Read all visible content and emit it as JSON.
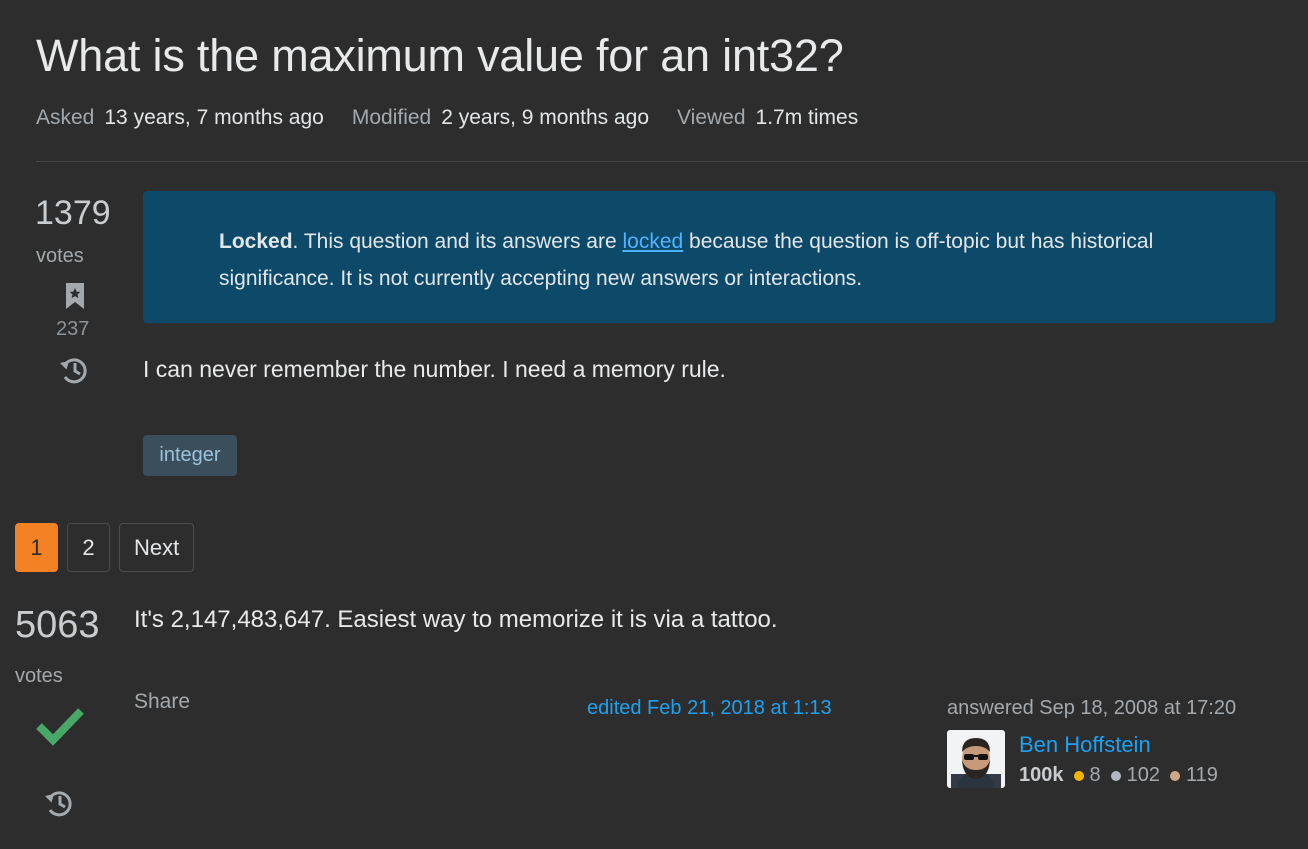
{
  "question": {
    "title": "What is the maximum value for an int32?",
    "meta": [
      {
        "label": "Asked",
        "value": "13 years, 7 months ago"
      },
      {
        "label": "Modified",
        "value": "2 years, 9 months ago"
      },
      {
        "label": "Viewed",
        "value": "1.7m times"
      }
    ],
    "votes": "1379",
    "votes_label": "votes",
    "bookmarks": "237",
    "body": "I can never remember the number. I need a memory rule.",
    "tags": [
      "integer"
    ]
  },
  "notice": {
    "bold": "Locked",
    "text_before_link": ". This question and its answers are ",
    "link": "locked",
    "text_after_link": " because the question is off-topic but has historical significance. It is not currently accepting new answers or interactions."
  },
  "pagination": {
    "pages": [
      "1",
      "2"
    ],
    "current": "1",
    "next_label": "Next"
  },
  "answer": {
    "votes": "5063",
    "votes_label": "votes",
    "body": "It's 2,147,483,647. Easiest way to memorize it is via a tattoo.",
    "share_label": "Share",
    "edited": "edited Feb 21, 2018 at 1:13",
    "answered": "answered Sep 18, 2008 at 17:20",
    "user": {
      "name": "Ben Hoffstein",
      "reputation": "100k",
      "gold": "8",
      "silver": "102",
      "bronze": "119"
    }
  },
  "colors": {
    "accent": "#f48225",
    "link": "#1da1f2",
    "notice_bg": "#0d4a69",
    "accepted": "#48a868",
    "gold": "#f1b600",
    "silver": "#b4b8bc",
    "bronze": "#d1a684"
  },
  "icons": {
    "lock": "lock-icon",
    "bookmark": "bookmark-icon",
    "history": "history-icon",
    "accepted": "accepted-check-icon"
  }
}
